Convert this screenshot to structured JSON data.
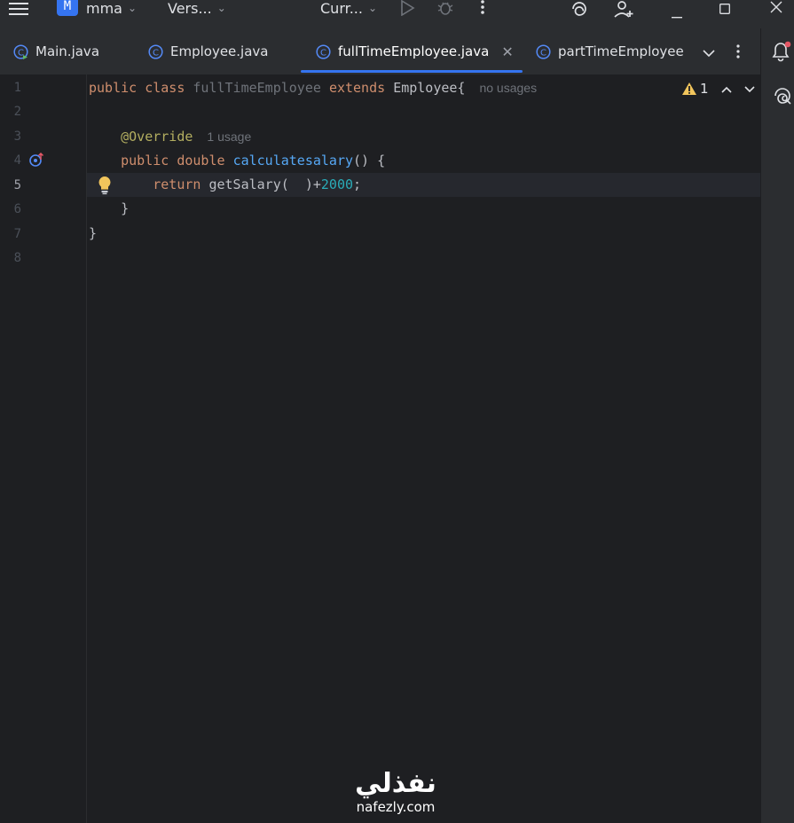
{
  "titlebar": {
    "project_badge": "M",
    "project_name": "mma",
    "vcs_label": "Vers...",
    "run_config": "Curr...",
    "colors": {
      "badge": "#3574f0",
      "background": "#2b2d30"
    }
  },
  "tabs": [
    {
      "label": "Main.java",
      "active": false,
      "icon": "class-runnable-icon"
    },
    {
      "label": "Employee.java",
      "active": false,
      "icon": "class-icon"
    },
    {
      "label": "fullTimeEmployee.java",
      "active": true,
      "icon": "class-icon"
    },
    {
      "label": "partTimeEmployee",
      "active": false,
      "icon": "class-icon"
    }
  ],
  "editor": {
    "line_numbers": [
      "1",
      "2",
      "3",
      "4",
      "5",
      "6",
      "7",
      "8"
    ],
    "current_line": "5",
    "lines": {
      "l1": {
        "kw1": "public",
        "kw2": "class",
        "name": "fullTimeEmployee",
        "kw3": "extends",
        "parent": "Employee{",
        "hint": "no usages"
      },
      "l3": {
        "annotation": "@Override",
        "hint": "1 usage"
      },
      "l4": {
        "kw1": "public",
        "kw2": "double",
        "method": "calculatesalary",
        "rest": "() {"
      },
      "l5": {
        "kw": "return",
        "call": "getSalary(",
        "rest": "  )+",
        "number": "2000",
        "end": ";"
      },
      "l6": {
        "text": "}"
      },
      "l7": {
        "text": "}"
      }
    },
    "warnings_count": "1"
  },
  "watermark": {
    "arabic": "نفذلي",
    "latin": "nafezly.com"
  }
}
